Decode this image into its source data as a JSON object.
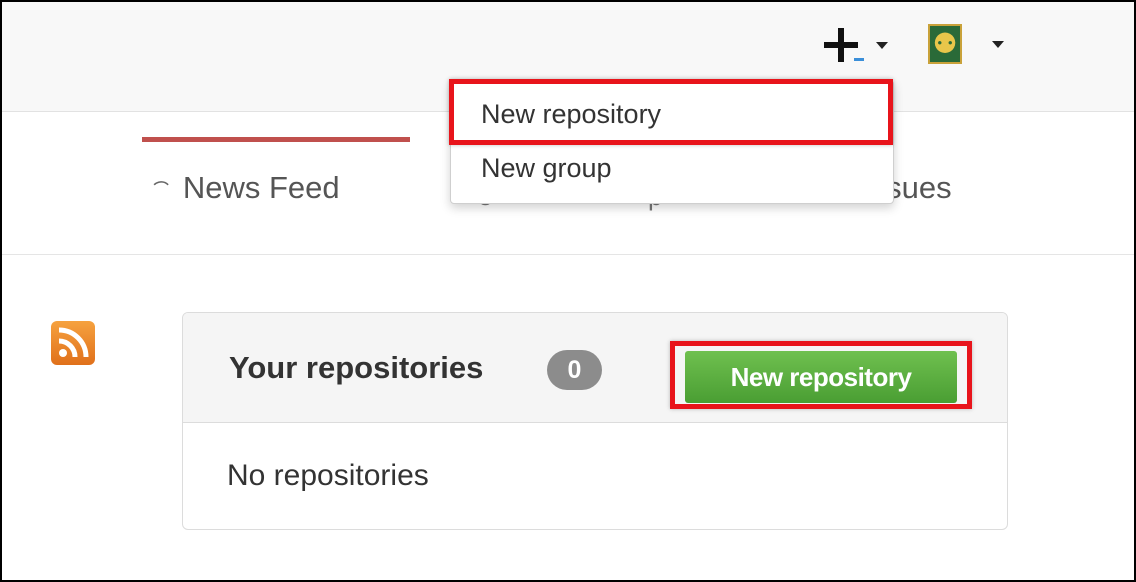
{
  "header": {
    "create_icon": "plus-icon",
    "user_avatar_icon": "user-avatar",
    "create_menu": {
      "items": [
        {
          "label": "New repository"
        },
        {
          "label": "New group"
        }
      ]
    }
  },
  "nav": {
    "tabs": [
      {
        "label": "News Feed",
        "icon": "rss-icon",
        "active": true
      },
      {
        "label": "Issues",
        "icon": "issues-icon",
        "active": false
      }
    ]
  },
  "feed_icon": "rss-feed-icon",
  "repositories_panel": {
    "title": "Your repositories",
    "count": "0",
    "new_button_label": "New repository",
    "empty_text": "No repositories"
  },
  "colors": {
    "highlight": "#e8141b",
    "button_green": "#5cb03f",
    "active_tab": "#c0504d",
    "feed_orange": "#f08a24"
  }
}
